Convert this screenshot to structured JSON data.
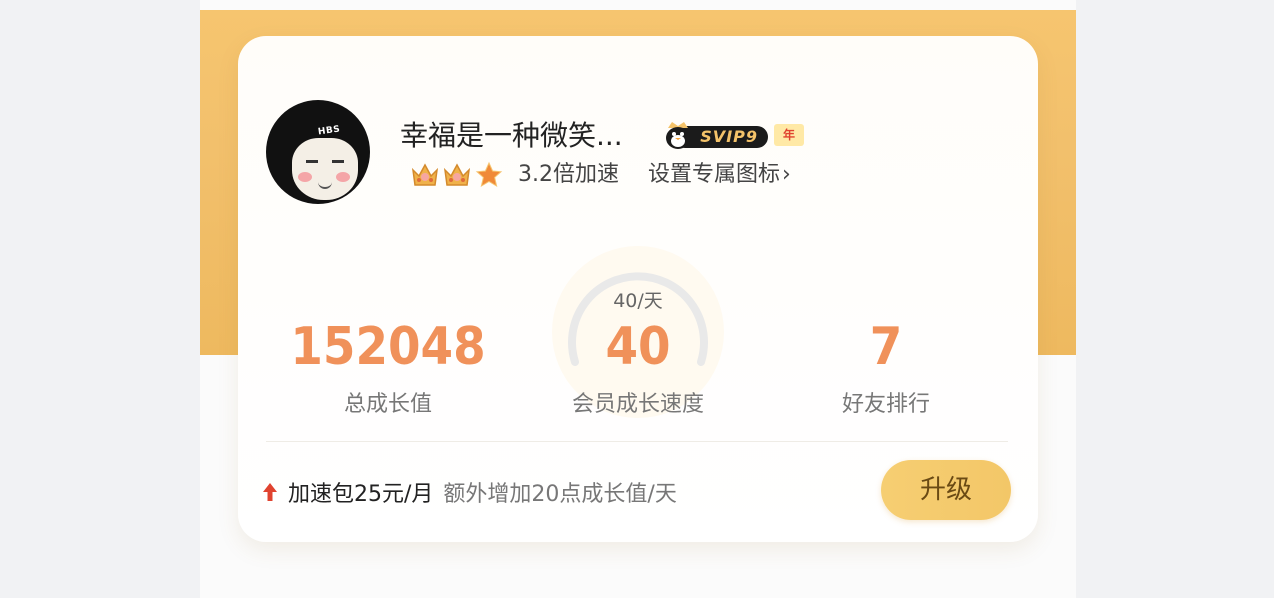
{
  "profile": {
    "username": "幸福是一种微笑...",
    "avatar_text": "HBS",
    "svip_label": "SVIP9",
    "year_badge": "年",
    "speed_multiplier": "3.2倍加速",
    "custom_icon_link": "设置专属图标",
    "chevron": "›"
  },
  "stats": {
    "total_growth_value": "152048",
    "total_growth_label": "总成长值",
    "speed_per_day": "40/天",
    "speed_value": "40",
    "speed_label": "会员成长速度",
    "friend_rank_value": "7",
    "friend_rank_label": "好友排行"
  },
  "boost": {
    "main_text": "加速包25元/月",
    "sub_text": "额外增加20点成长值/天",
    "upgrade_button_label": "升级"
  },
  "icons": {
    "crown_color": "#f0b24a",
    "star_color": "#f08a38",
    "up_arrow_color": "#e0432f"
  },
  "colors": {
    "accent": "#f0915a",
    "banner": "#f2c06c"
  }
}
